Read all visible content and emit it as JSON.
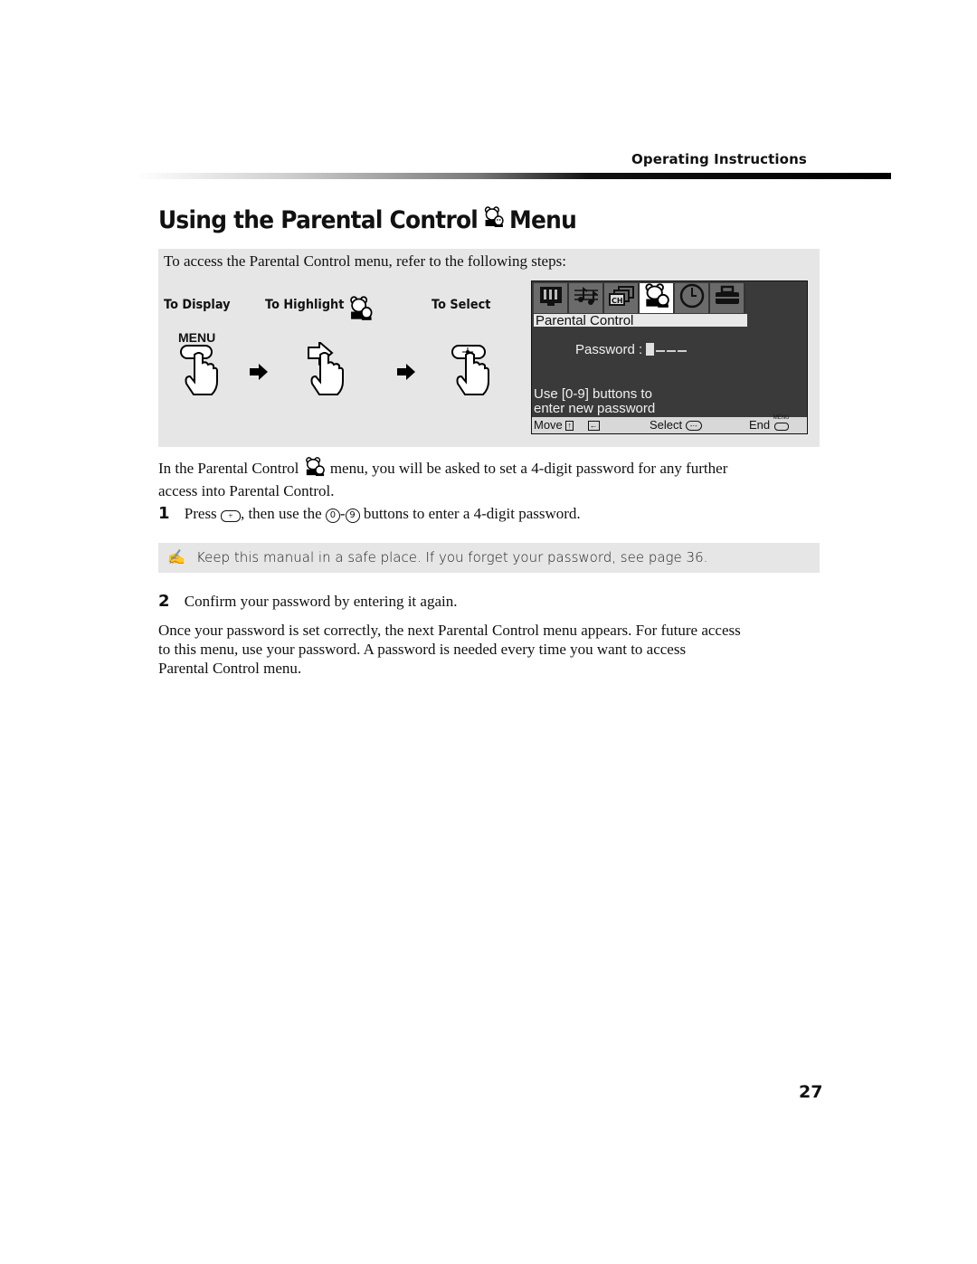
{
  "header": {
    "section_label": "Operating Instructions"
  },
  "title": {
    "before_icon": "Using the Parental Control",
    "icon": "parental-control-bears-icon",
    "after_icon": "Menu"
  },
  "panel": {
    "intro": "To access the Parental Control menu, refer to the following steps:",
    "steps": [
      {
        "label": "To Display",
        "button_label": "MENU",
        "icon": "hand-press-menu-button-icon"
      },
      {
        "label": "To Highlight",
        "icon": "hand-press-arrow-button-icon",
        "label_icon": "parental-control-bears-icon"
      },
      {
        "label": "To Select",
        "icon": "hand-press-select-button-icon"
      }
    ],
    "arrow_icon": "right-arrow-icon"
  },
  "osd": {
    "tabs": [
      {
        "icon": "video-icon",
        "active": false
      },
      {
        "icon": "audio-icon",
        "active": false
      },
      {
        "icon": "channel-icon",
        "active": false,
        "text": "CH"
      },
      {
        "icon": "parental-control-icon",
        "active": true
      },
      {
        "icon": "timer-clock-icon",
        "active": false
      },
      {
        "icon": "setup-icon",
        "active": false
      }
    ],
    "title": "Parental Control",
    "password_label": "Password :",
    "help_line1": "Use [0-9] buttons to",
    "help_line2": "enter new password",
    "footer": {
      "move": "Move",
      "select": "Select",
      "end": "End",
      "end_button": "MENU"
    }
  },
  "body": {
    "para1_before": "In the Parental Control",
    "para1_after": "menu, you will be asked to set a 4-digit password for any further",
    "para1_line2": "access into Parental Control.",
    "step1_num": "1",
    "step1_a": "Press",
    "step1_b": ", then use the",
    "step1_c": "buttons to enter a 4-digit password.",
    "digit_from": "0",
    "digit_to": "9",
    "note": "Keep this manual in a safe place. If you forget your password, see page 36.",
    "step2_num": "2",
    "step2": "Confirm your password by entering it again.",
    "para2_line1": "Once your password is set correctly, the next Parental Control menu appears. For future access",
    "para2_line2": "to this menu, use your password. A password is needed every time you want to access",
    "para2_line3": "Parental Control menu."
  },
  "page_number": "27"
}
